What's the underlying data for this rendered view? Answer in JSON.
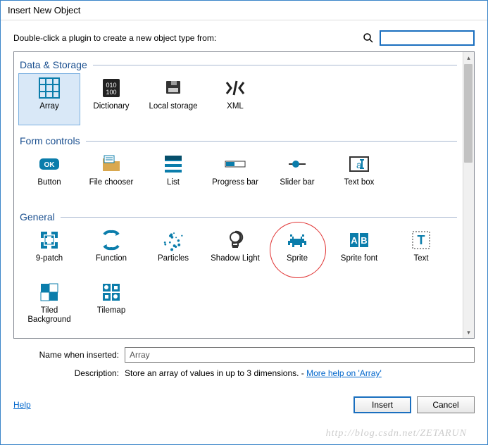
{
  "title": "Insert New Object",
  "instruction": "Double-click a plugin to create a new object type from:",
  "search": {
    "placeholder": ""
  },
  "categories": [
    {
      "name": "Data & Storage",
      "items": [
        {
          "id": "array",
          "label": "Array",
          "selected": true
        },
        {
          "id": "dictionary",
          "label": "Dictionary"
        },
        {
          "id": "localstorage",
          "label": "Local storage"
        },
        {
          "id": "xml",
          "label": "XML"
        }
      ]
    },
    {
      "name": "Form controls",
      "items": [
        {
          "id": "button",
          "label": "Button"
        },
        {
          "id": "filechooser",
          "label": "File chooser"
        },
        {
          "id": "list",
          "label": "List"
        },
        {
          "id": "progressbar",
          "label": "Progress bar"
        },
        {
          "id": "sliderbar",
          "label": "Slider bar"
        },
        {
          "id": "textbox",
          "label": "Text box"
        }
      ]
    },
    {
      "name": "General",
      "items": [
        {
          "id": "9patch",
          "label": "9-patch"
        },
        {
          "id": "function",
          "label": "Function"
        },
        {
          "id": "particles",
          "label": "Particles"
        },
        {
          "id": "shadowlight",
          "label": "Shadow Light"
        },
        {
          "id": "sprite",
          "label": "Sprite",
          "circled": true
        },
        {
          "id": "spritefont",
          "label": "Sprite font"
        },
        {
          "id": "text",
          "label": "Text"
        },
        {
          "id": "tiledbg",
          "label": "Tiled Background"
        },
        {
          "id": "tilemap",
          "label": "Tilemap"
        }
      ]
    }
  ],
  "form": {
    "name_label": "Name when inserted:",
    "name_value": "Array",
    "desc_label": "Description:",
    "desc_text": "Store an array of values in up to 3 dimensions. - ",
    "desc_link": "More help on 'Array'"
  },
  "footer": {
    "help": "Help",
    "insert": "Insert",
    "cancel": "Cancel"
  },
  "watermark": "http://blog.csdn.net/ZETARUN"
}
